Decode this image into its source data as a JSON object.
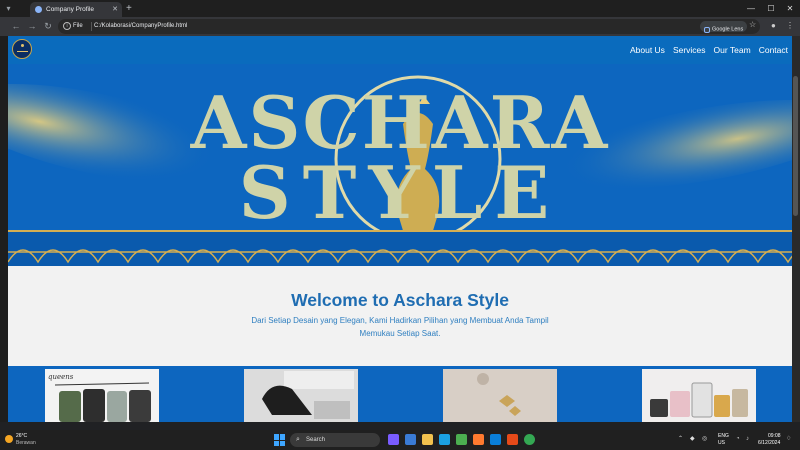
{
  "browser": {
    "tab_title": "Company Profile",
    "tab_close": "✕",
    "new_tab": "+",
    "scheme_label": "File",
    "url": "C:/Kolaborasi/CompanyProfile.html",
    "lens_label": "Google Lens",
    "window_controls": [
      "—",
      "☐",
      "✕"
    ]
  },
  "site": {
    "nav": [
      "About Us",
      "Services",
      "Our Team",
      "Contact"
    ],
    "hero_line1": "ASCHARA",
    "hero_line2": "STYLE",
    "welcome_title": "Welcome to Aschara Style",
    "welcome_text": "Dari Setiap Desain yang Elegan, Kami Hadirkan Pilihan yang Membuat Anda Tampil Memukau Setiap Saat.",
    "card1_label": "queens"
  },
  "taskbar": {
    "temp": "26°C",
    "condition": "Berawan",
    "search_label": "Search",
    "lang": "ENG",
    "region": "US",
    "time": "09:08",
    "date": "6/12/2024"
  },
  "colors": {
    "brand_blue": "#0d66bf",
    "heading_blue": "#1f6db2",
    "gold": "#d4ae52"
  }
}
